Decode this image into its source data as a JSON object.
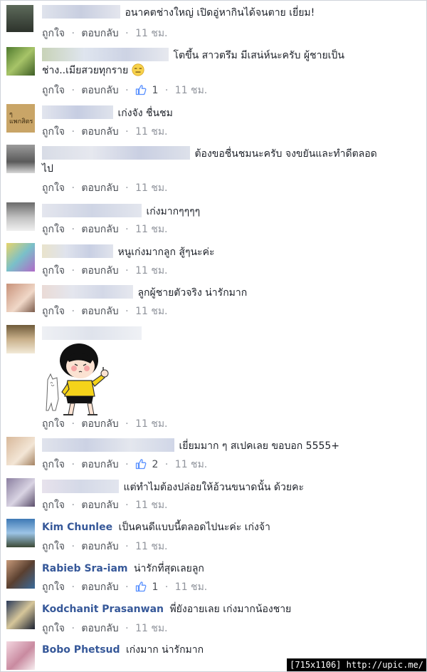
{
  "actions": {
    "like": "ถูกใจ",
    "reply": "ตอบกลับ",
    "dot": "·"
  },
  "comments": [
    {
      "name": "",
      "text": "อนาคตช่างใหญ่ เปิดอู่หากินได้จนตาย เยี่ยม!",
      "likes": "",
      "time": "11 ชม."
    },
    {
      "name": "",
      "text": "โตขึ้น สาวตรึม มีเสน่ห์นะครับ ผู้ชายเป็น",
      "text2": "ช่าง..เมียสวยทุกราย",
      "likes": "1",
      "time": "11 ชม.",
      "emoji": "expressionless-face-emoji"
    },
    {
      "name": "",
      "text": "เก่งจัง ชื่นชม",
      "likes": "",
      "time": "11 ชม."
    },
    {
      "name": "",
      "text": "ต้องขอชื่นชมนะครับ จงขยันและทำดีตลอด",
      "text2": "ไป",
      "likes": "",
      "time": "11 ชม."
    },
    {
      "name": "",
      "text": "เก่งมากๆๆๆๆ",
      "likes": "",
      "time": "11 ชม."
    },
    {
      "name": "",
      "text": "หนูเก่งมากลูก สู้ๆนะค่ะ",
      "likes": "",
      "time": "11 ชม."
    },
    {
      "name": "",
      "text": "ลูกผู้ชายตัวจริง น่ารักมาก",
      "likes": "",
      "time": "11 ชม."
    },
    {
      "name": "",
      "text": "",
      "likes": "",
      "time": "11 ชม.",
      "sticker": "thumbs-up-girl-sticker"
    },
    {
      "name": "",
      "text": "เยี่ยมมาก ๆ สเปคเลย ขอบอก 5555+",
      "likes": "2",
      "time": "11 ชม."
    },
    {
      "name": "",
      "text": "แต่ทำไมต้องปล่อยให้อ้วนขนาดนั้น ด้วยคะ",
      "likes": "",
      "time": "11 ชม."
    },
    {
      "name": "Kim Chunlee",
      "text": "เป็นคนดีแบบนี้ตลอดไปนะค่ะ เก่งจ้า",
      "likes": "",
      "time": "11 ชม."
    },
    {
      "name": "Rabieb Sra-iam",
      "text": "น่ารักที่สุดเลยลูก",
      "likes": "1",
      "time": "11 ชม."
    },
    {
      "name": "Kodchanit Prasanwan",
      "text": "พี่ยังอายเลย เก่งมากน้องชาย",
      "likes": "",
      "time": "11 ชม."
    },
    {
      "name": "Bobo Phetsud",
      "text": "เก่งมาก น่ารักมาก",
      "likes": "",
      "time": ""
    }
  ],
  "watermark": "[715x1106] http://upic.me/",
  "colors": {
    "name": "#365899",
    "meta": "#90949c",
    "like": "#5890ff"
  }
}
